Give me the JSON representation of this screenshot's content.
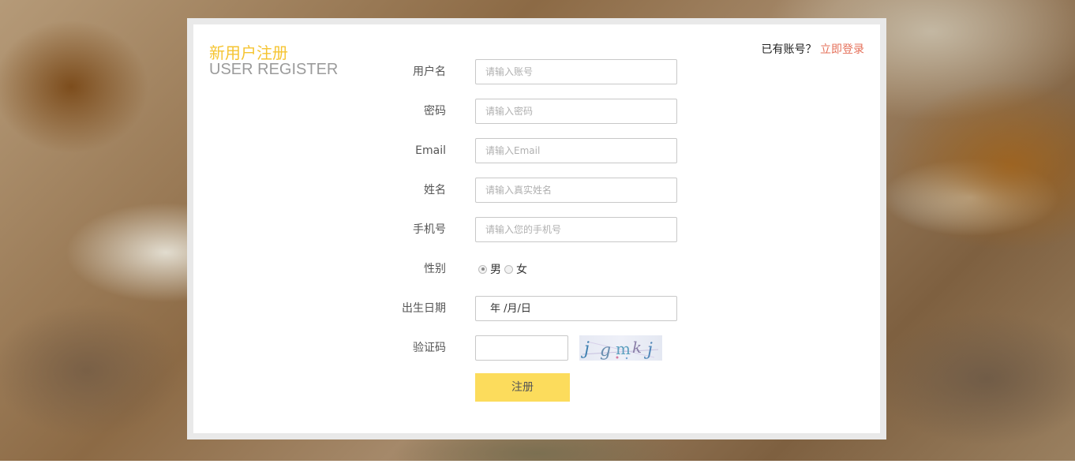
{
  "header": {
    "title_cn": "新用户注册",
    "title_en": "USER REGISTER",
    "login_prompt": "已有账号？",
    "login_link": "立即登录"
  },
  "form": {
    "username": {
      "label": "用户名",
      "placeholder": "请输入账号"
    },
    "password": {
      "label": "密码",
      "placeholder": "请输入密码"
    },
    "email": {
      "label": "Email",
      "placeholder": "请输入Email"
    },
    "realname": {
      "label": "姓名",
      "placeholder": "请输入真实姓名"
    },
    "phone": {
      "label": "手机号",
      "placeholder": "请输入您的手机号"
    },
    "gender": {
      "label": "性别",
      "option_male": "男",
      "option_female": "女",
      "selected": "男"
    },
    "birthday": {
      "label": "出生日期",
      "value": "年 /月/日"
    },
    "captcha": {
      "label": "验证码",
      "value": "",
      "image_text": "jgmkj"
    },
    "submit_label": "注册"
  },
  "colors": {
    "accent_yellow": "#f5c431",
    "button_yellow": "#fcdc5c",
    "link_red": "#e5705a"
  }
}
